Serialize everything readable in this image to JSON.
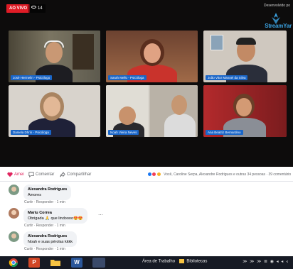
{
  "video": {
    "live_badge": "AO VIVO",
    "viewer_count": "14",
    "brand_sub": "Desenvolvido po",
    "brand_name": "StreamYar",
    "participants": [
      {
        "name": "José Hermelin - Psicólogo"
      },
      {
        "name": "Sarah Mello - Psicóloga"
      },
      {
        "name": "João Vitor Manoel da Silva"
      },
      {
        "name": "Daniela Dhrin - Psicóloga"
      },
      {
        "name": "Noah Vieira Neves"
      },
      {
        "name": "Ana Beatriz Bernardino"
      }
    ]
  },
  "post_bar": {
    "like_label": "Amei",
    "comment_label": "Comentar",
    "share_label": "Compartilhar",
    "reactions_text": "Você, Caroline Serpa, Alexandre Rodrigues e outras 34 pessoas · 39 comentário"
  },
  "comments": [
    {
      "author": "Alexandra Rodrigues",
      "text": "Amores",
      "like": "Curtir",
      "reply": "Responder",
      "time": "1 min"
    },
    {
      "author": "Mariu Correa",
      "text": "Obrigada 🙏 que lindoooo😍😍",
      "like": "Curtir",
      "reply": "Responder",
      "time": "1 min"
    },
    {
      "author": "Alexandra Rodrigues",
      "text": "Noah e suas pérolas kkkk",
      "like": "Curtir",
      "reply": "Responder",
      "time": "1 min"
    }
  ],
  "taskbar": {
    "label": "Área de Trabalho",
    "libraries": "Bibliotecas",
    "tray": "≫ ≫ ≫ ≣ ◉ ◂ ◂ ◃"
  },
  "colors": {
    "live_red": "#e01c26",
    "name_tag_blue": "#1a66c8",
    "brand_blue": "#3aa1e0",
    "fb_gray": "#65676b",
    "bubble_bg": "#f0f2f5"
  }
}
